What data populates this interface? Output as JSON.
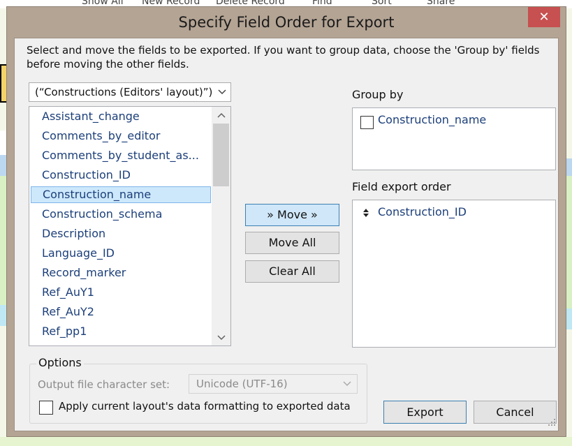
{
  "background": {
    "toolbar_items": [
      "Show All",
      "New Record",
      "Delete Record",
      "Find",
      "Sort",
      "Share"
    ]
  },
  "dialog": {
    "title": "Specify Field Order for Export",
    "close_glyph": "✕",
    "instructions": "Select and move the fields to be exported. If you want to group data, choose the 'Group by' fields before moving the other fields.",
    "layout_select": "(“Constructions (Editors' layout)”)",
    "fields": [
      "Assistant_change",
      "Comments_by_editor",
      "Comments_by_student_as...",
      "Construction_ID",
      "Construction_name",
      "Construction_schema",
      "Description",
      "Language_ID",
      "Record_marker",
      "Ref_AuY1",
      "Ref_AuY2",
      "Ref_pp1"
    ],
    "selected_field": "Construction_name",
    "buttons": {
      "move": "» Move »",
      "move_all": "Move All",
      "clear_all": "Clear All",
      "export": "Export",
      "cancel": "Cancel"
    },
    "group_by": {
      "label": "Group by",
      "items": [
        "Construction_name"
      ]
    },
    "export_order": {
      "label": "Field export order",
      "items": [
        "Construction_ID"
      ]
    },
    "options": {
      "legend": "Options",
      "charset_label": "Output file character set:",
      "charset_value": "Unicode (UTF-16)",
      "apply_formatting_label": "Apply current layout's data formatting to exported data",
      "apply_formatting_checked": false
    }
  },
  "colors": {
    "title_bar": "#b4a494",
    "close_button": "#c75050",
    "field_text": "#1c3f7a",
    "selection": "#cde8fb",
    "focus_border": "#3c7fb1"
  }
}
